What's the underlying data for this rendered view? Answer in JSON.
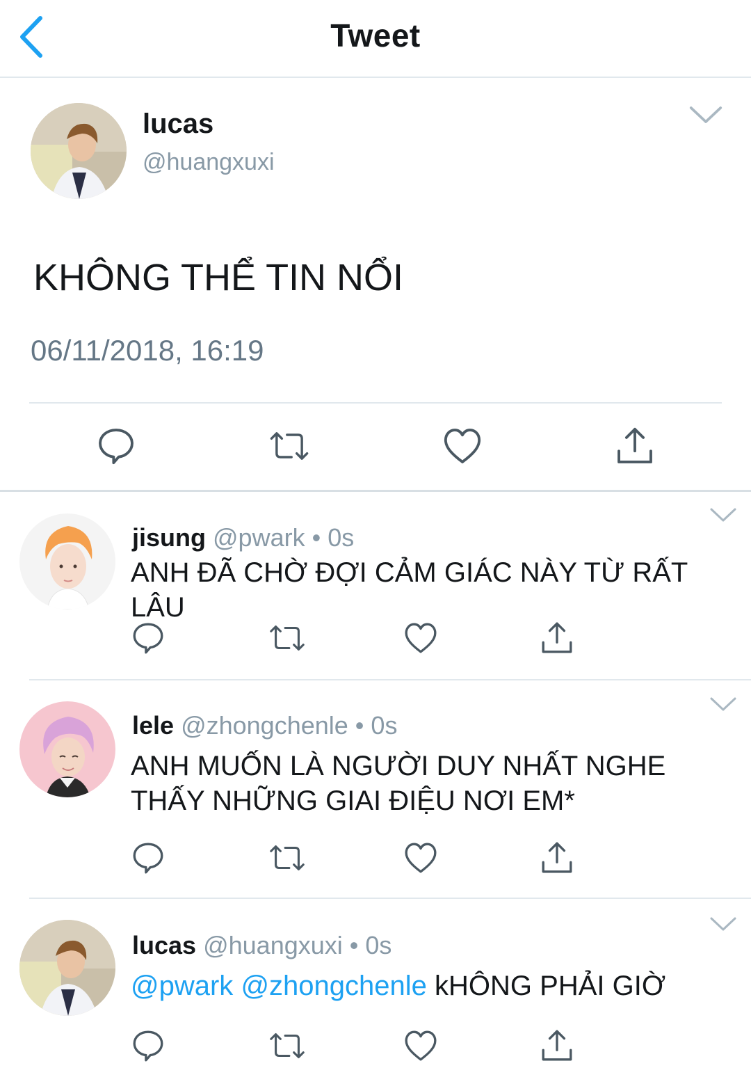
{
  "header": {
    "title": "Tweet"
  },
  "main_tweet": {
    "name": "lucas",
    "handle": "@huangxuxi",
    "text": "KHÔNG THỂ TIN NỔI",
    "timestamp": "06/11/2018, 16:19"
  },
  "replies": [
    {
      "name": "jisung",
      "handle": "@pwark",
      "time": "0s",
      "text": "ANH ĐÃ CHỜ ĐỢI CẢM GIÁC NÀY TỪ RẤT LÂU"
    },
    {
      "name": "lele",
      "handle": "@zhongchenle",
      "time": "0s",
      "text": "ANH MUỐN LÀ NGƯỜI DUY NHẤT NGHE THẤY NHỮNG GIAI ĐIỆU NƠI EM*"
    },
    {
      "name": "lucas",
      "handle": "@huangxuxi",
      "time": "0s",
      "mentions": [
        "@pwark",
        "@zhongchenle"
      ],
      "text": "kHÔNG PHẢI GIỜ"
    }
  ],
  "separator": "•",
  "colors": {
    "accent": "#1da1f2",
    "text_primary": "#14171a",
    "text_secondary": "#8899a6",
    "divider": "#e1e8ed",
    "icon": "#4a5862"
  },
  "icons": [
    "back-chevron-icon",
    "chevron-down-icon",
    "reply-icon",
    "retweet-icon",
    "like-icon",
    "share-icon"
  ]
}
